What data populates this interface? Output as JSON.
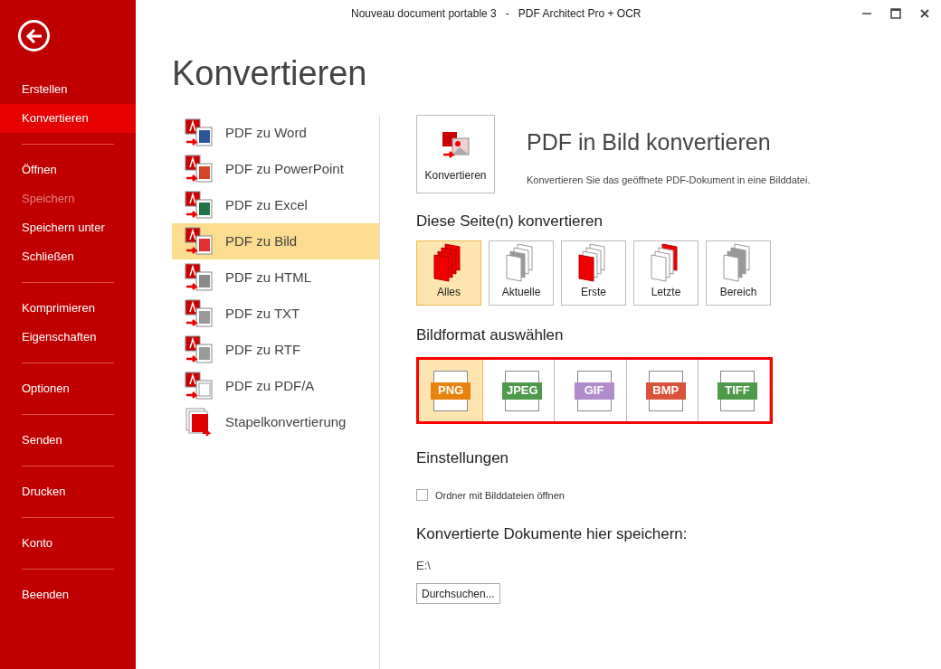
{
  "window": {
    "title": "Nouveau document portable 3   -   PDF Architect Pro + OCR"
  },
  "sidebar": {
    "groups": [
      [
        {
          "label": "Erstellen",
          "selected": false,
          "disabled": false
        },
        {
          "label": "Konvertieren",
          "selected": true,
          "disabled": false
        }
      ],
      [
        {
          "label": "Öffnen",
          "selected": false,
          "disabled": false
        },
        {
          "label": "Speichern",
          "selected": false,
          "disabled": true
        },
        {
          "label": "Speichern unter",
          "selected": false,
          "disabled": false
        },
        {
          "label": "Schließen",
          "selected": false,
          "disabled": false
        }
      ],
      [
        {
          "label": "Komprimieren",
          "selected": false,
          "disabled": false
        },
        {
          "label": "Eigenschaften",
          "selected": false,
          "disabled": false
        }
      ],
      [
        {
          "label": "Optionen",
          "selected": false,
          "disabled": false
        }
      ],
      [
        {
          "label": "Senden",
          "selected": false,
          "disabled": false
        }
      ],
      [
        {
          "label": "Drucken",
          "selected": false,
          "disabled": false
        }
      ],
      [
        {
          "label": "Konto",
          "selected": false,
          "disabled": false
        }
      ],
      [
        {
          "label": "Beenden",
          "selected": false,
          "disabled": false
        }
      ]
    ]
  },
  "page_title": "Konvertieren",
  "conversions": [
    {
      "label": "PDF zu Word",
      "kind": "word",
      "selected": false
    },
    {
      "label": "PDF zu PowerPoint",
      "kind": "powerpoint",
      "selected": false
    },
    {
      "label": "PDF zu Excel",
      "kind": "excel",
      "selected": false
    },
    {
      "label": "PDF zu Bild",
      "kind": "image",
      "selected": true
    },
    {
      "label": "PDF zu HTML",
      "kind": "html",
      "selected": false
    },
    {
      "label": "PDF zu TXT",
      "kind": "txt",
      "selected": false
    },
    {
      "label": "PDF zu RTF",
      "kind": "rtf",
      "selected": false
    },
    {
      "label": "PDF zu PDF/A",
      "kind": "pdfa",
      "selected": false
    },
    {
      "label": "Stapelkonvertierung",
      "kind": "batch",
      "selected": false
    }
  ],
  "detail": {
    "button": "Konvertieren",
    "title": "PDF in Bild konvertieren",
    "description": "Konvertieren Sie das geöffnete PDF-Dokument in eine Bilddatei.",
    "pages_heading": "Diese Seite(n) konvertieren",
    "pages": [
      {
        "label": "Alles",
        "kind": "all",
        "selected": true
      },
      {
        "label": "Aktuelle",
        "kind": "current",
        "selected": false
      },
      {
        "label": "Erste",
        "kind": "first",
        "selected": false
      },
      {
        "label": "Letzte",
        "kind": "last",
        "selected": false
      },
      {
        "label": "Bereich",
        "kind": "range",
        "selected": false
      }
    ],
    "format_heading": "Bildformat auswählen",
    "formats": [
      {
        "label": "PNG",
        "color": "#e8820c",
        "selected": true
      },
      {
        "label": "JPEG",
        "color": "#4e9a4b",
        "selected": false
      },
      {
        "label": "GIF",
        "color": "#b08ccc",
        "selected": false
      },
      {
        "label": "BMP",
        "color": "#d9523a",
        "selected": false
      },
      {
        "label": "TIFF",
        "color": "#4e9a4b",
        "selected": false
      }
    ],
    "settings_heading": "Einstellungen",
    "open_folder": {
      "label": "Ordner mit Bilddateien öffnen",
      "checked": false
    },
    "save_heading": "Konvertierte Dokumente hier speichern:",
    "save_path": "E:\\",
    "browse_button": "Durchsuchen..."
  }
}
